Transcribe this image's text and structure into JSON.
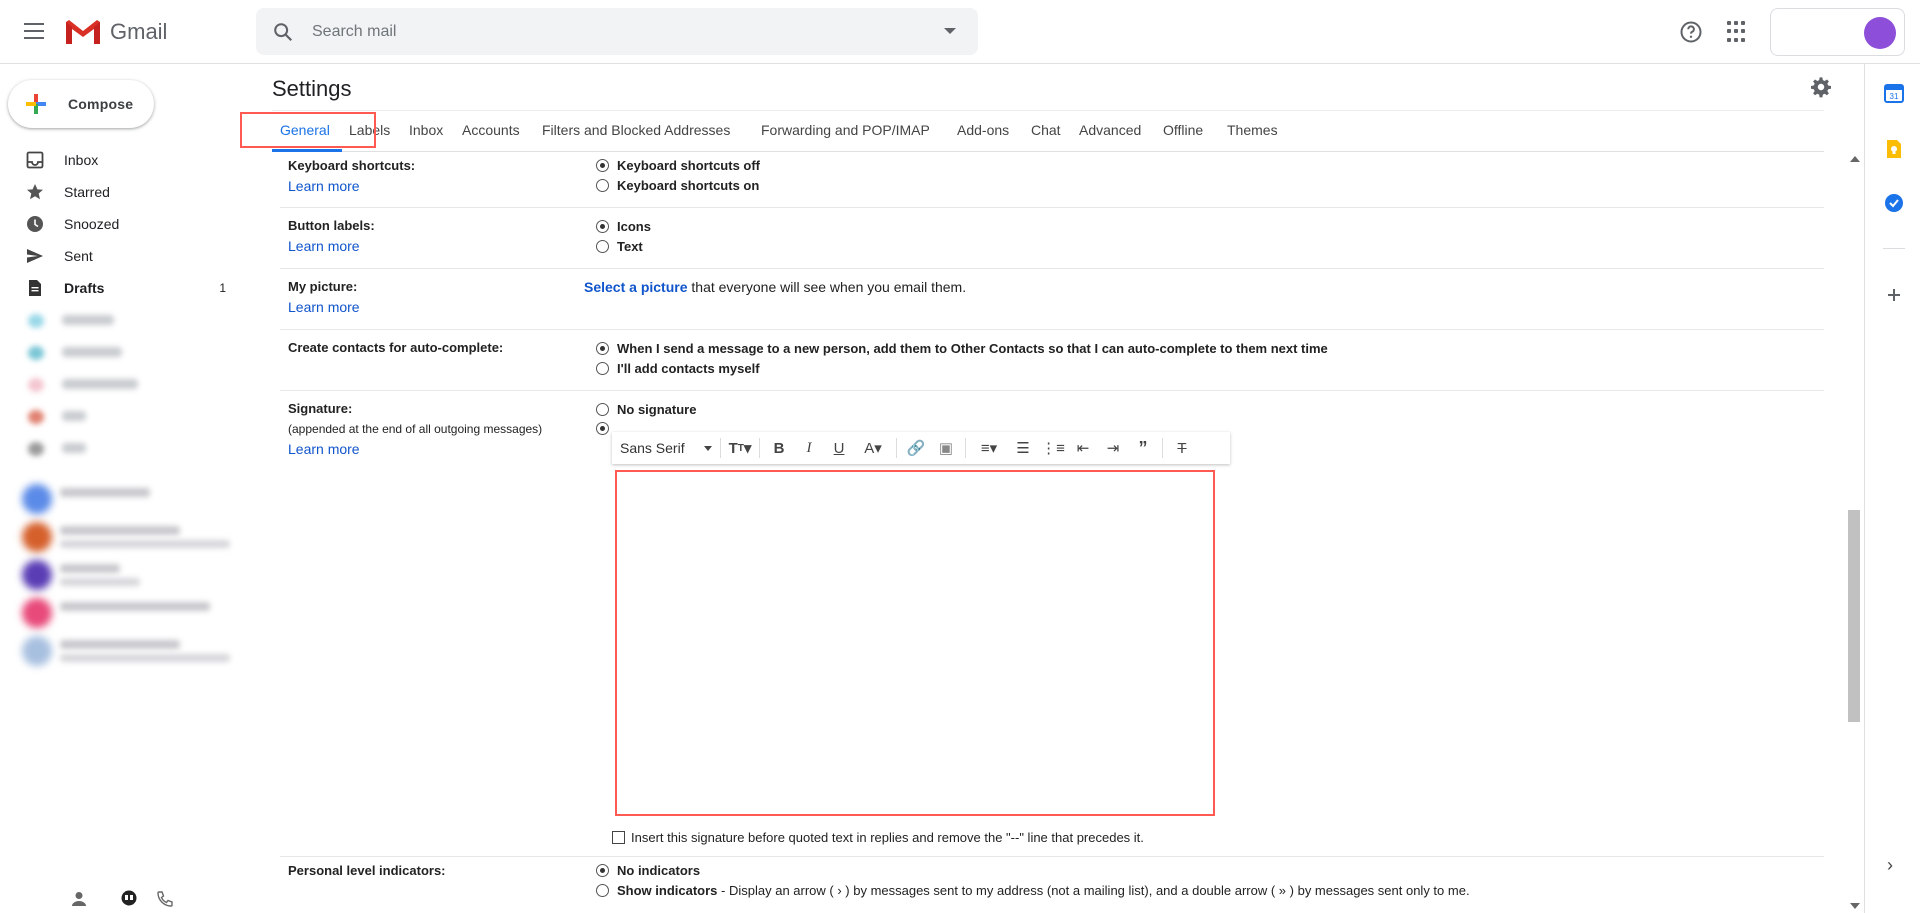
{
  "header": {
    "app_name": "Gmail",
    "search_placeholder": "Search mail"
  },
  "sidebar": {
    "compose_label": "Compose",
    "items": [
      {
        "label": "Inbox",
        "icon": "inbox-icon"
      },
      {
        "label": "Starred",
        "icon": "star-icon"
      },
      {
        "label": "Snoozed",
        "icon": "clock-icon"
      },
      {
        "label": "Sent",
        "icon": "send-icon"
      },
      {
        "label": "Drafts",
        "icon": "draft-icon",
        "count": "1"
      }
    ]
  },
  "settings": {
    "title": "Settings",
    "tabs": [
      "General",
      "Labels",
      "Inbox",
      "Accounts",
      "Filters and Blocked Addresses",
      "Forwarding and POP/IMAP",
      "Add-ons",
      "Chat",
      "Advanced",
      "Offline",
      "Themes"
    ],
    "active_tab": "General",
    "learn_more": "Learn more",
    "keyboard": {
      "label": "Keyboard shortcuts:",
      "option_off": "Keyboard shortcuts off",
      "option_on": "Keyboard shortcuts on",
      "selected": "off"
    },
    "button_labels": {
      "label": "Button labels:",
      "option_icons": "Icons",
      "option_text": "Text",
      "selected": "icons"
    },
    "my_picture": {
      "label": "My picture:",
      "link": "Select a picture",
      "suffix": "that everyone will see when you email them."
    },
    "contacts": {
      "label": "Create contacts for auto-complete:",
      "option_auto": "When I send a message to a new person, add them to Other Contacts so that I can auto-complete to them next time",
      "option_manual": "I'll add contacts myself",
      "selected": "auto"
    },
    "signature": {
      "label": "Signature:",
      "sub": "(appended at the end of all outgoing messages)",
      "option_none": "No signature",
      "selected": "custom",
      "font": "Sans Serif",
      "insert_label": "Insert this signature before quoted text in replies and remove the \"--\" line that precedes it.",
      "insert_checked": false
    },
    "indicators": {
      "label": "Personal level indicators:",
      "option_none": "No indicators",
      "option_show": "Show indicators",
      "option_show_desc": "- Display an arrow ( › ) by messages sent to my address (not a mailing list), and a double arrow ( » ) by messages sent only to me.",
      "selected": "none"
    }
  },
  "colors": {
    "accent": "#1a73e8",
    "link": "#1155cc",
    "highlight": "#ff5a52",
    "avatar": "#8d4fd9"
  }
}
